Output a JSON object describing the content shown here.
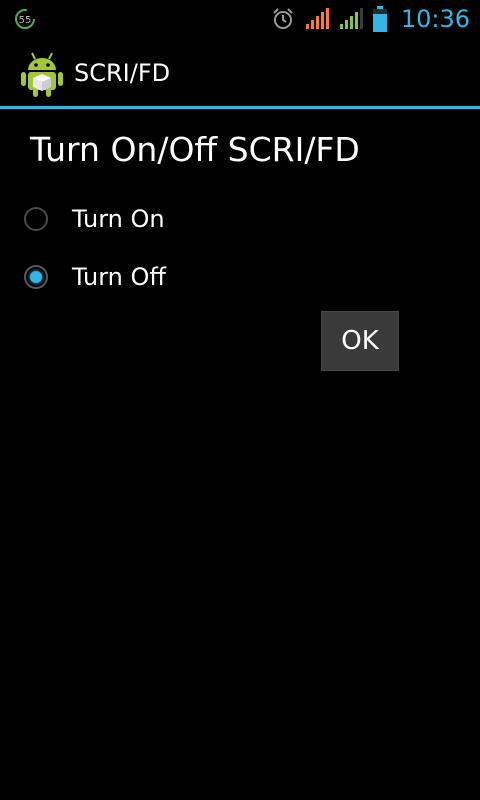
{
  "status_bar": {
    "notification_badge": "55",
    "clock": "10:36",
    "icons": [
      "notification-count-icon",
      "alarm-icon",
      "signal-orange-icon",
      "signal-green-icon",
      "battery-icon"
    ],
    "accent_color": "#33b5e5"
  },
  "action_bar": {
    "title": "SCRI/FD",
    "icon": "android-app-icon"
  },
  "main": {
    "heading": "Turn On/Off SCRI/FD",
    "options": [
      {
        "label": "Turn On",
        "selected": false
      },
      {
        "label": "Turn Off",
        "selected": true
      }
    ],
    "ok_label": "OK"
  }
}
